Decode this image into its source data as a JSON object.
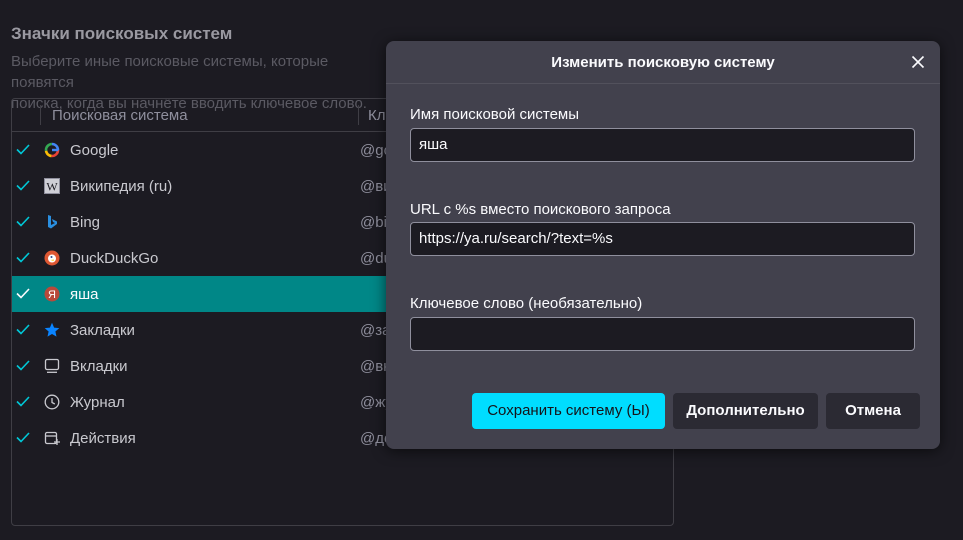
{
  "page": {
    "section_title": "Значки поисковых систем",
    "description_line1": "Выберите иные поисковые системы, которые появятся",
    "description_line2": "поиска, когда вы начнёте вводить ключевое слово."
  },
  "table": {
    "col_name": "Поисковая система",
    "col_keyword": "Кл",
    "rows": [
      {
        "name": "Google",
        "keyword": "@go",
        "icon": "google-icon",
        "selected": false
      },
      {
        "name": "Википедия (ru)",
        "keyword": "@ви",
        "icon": "wikipedia-icon",
        "selected": false
      },
      {
        "name": "Bing",
        "keyword": "@bi",
        "icon": "bing-icon",
        "selected": false
      },
      {
        "name": "DuckDuckGo",
        "keyword": "@du",
        "icon": "duckduckgo-icon",
        "selected": false
      },
      {
        "name": "яша",
        "keyword": "",
        "icon": "yandex-icon",
        "selected": true
      },
      {
        "name": "Закладки",
        "keyword": "@за",
        "icon": "star-icon",
        "selected": false
      },
      {
        "name": "Вкладки",
        "keyword": "@вк",
        "icon": "tabs-icon",
        "selected": false
      },
      {
        "name": "Журнал",
        "keyword": "@жу",
        "icon": "clock-icon",
        "selected": false
      },
      {
        "name": "Действия",
        "keyword": "@де",
        "icon": "actions-icon",
        "selected": false
      }
    ]
  },
  "dialog": {
    "title": "Изменить поисковую систему",
    "name_label": "Имя поисковой системы",
    "name_value": "яша",
    "url_label": "URL с %s вместо поискового запроса",
    "url_value": "https://ya.ru/search/?text=%s",
    "keyword_label": "Ключевое слово (необязательно)",
    "keyword_value": "",
    "save_button": "Сохранить систему (Ы)",
    "advanced_button": "Дополнительно",
    "cancel_button": "Отмена"
  },
  "colors": {
    "background": "#1c1b22",
    "dialog": "#42414d",
    "accent": "#00ddff",
    "selection": "#008787",
    "check": "#00c8d7"
  }
}
